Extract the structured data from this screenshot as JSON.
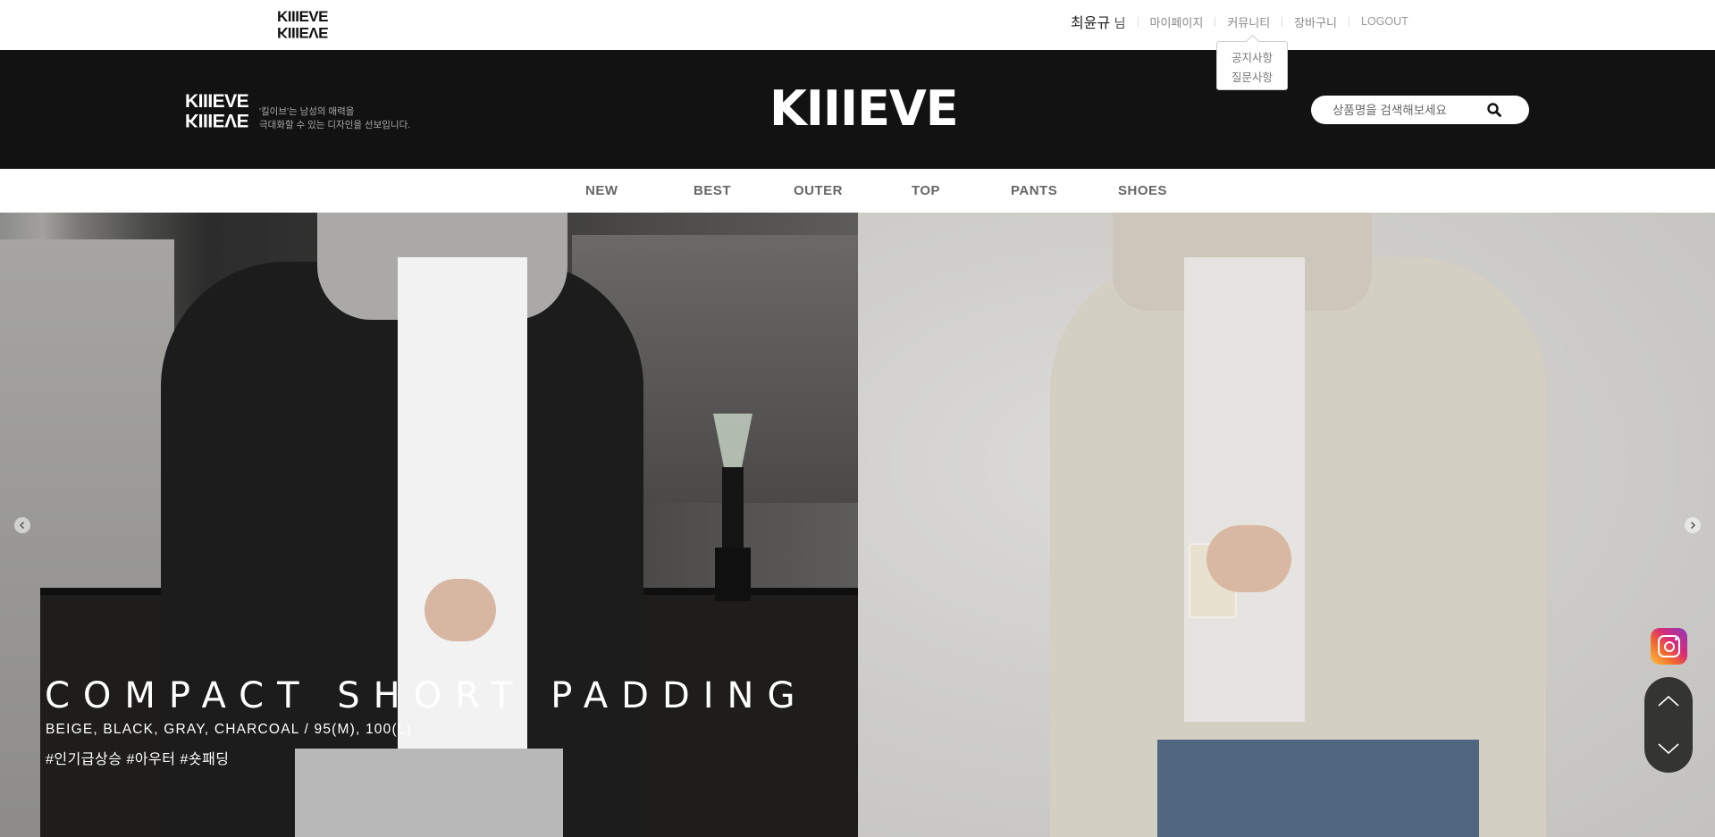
{
  "brand": {
    "mini_logo": "KIIIEVE",
    "name": "KIIIEVE",
    "tagline_line1": "'킬이브'는 남성의 매력을",
    "tagline_line2": "극대화할 수 있는 디자인을 선보입니다."
  },
  "utility": {
    "user_name": "최윤규",
    "user_suffix": "님",
    "links": [
      "마이페이지",
      "커뮤니티",
      "장바구니",
      "LOGOUT"
    ]
  },
  "community_dropdown": {
    "items": [
      "공지사항",
      "질문사항"
    ]
  },
  "search": {
    "placeholder": "상품명을 검색해보세요",
    "icon": "search-icon"
  },
  "nav": {
    "items": [
      "NEW",
      "BEST",
      "OUTER",
      "TOP",
      "PANTS",
      "SHOES"
    ]
  },
  "hero": {
    "title": "COMPACT SHORT PADDING",
    "subtitle": "BEIGE, BLACK, GRAY, CHARCOAL / 95(M), 100(L)",
    "tags": "#인기급상승 #아우터 #숏패딩"
  },
  "widgets": {
    "social_icon": "instagram-icon",
    "scroll_up_icon": "chevron-up-icon",
    "scroll_down_icon": "chevron-down-icon"
  },
  "colors": {
    "header_bg": "#121212",
    "accent_text": "#ffffff",
    "nav_text": "#666666"
  }
}
